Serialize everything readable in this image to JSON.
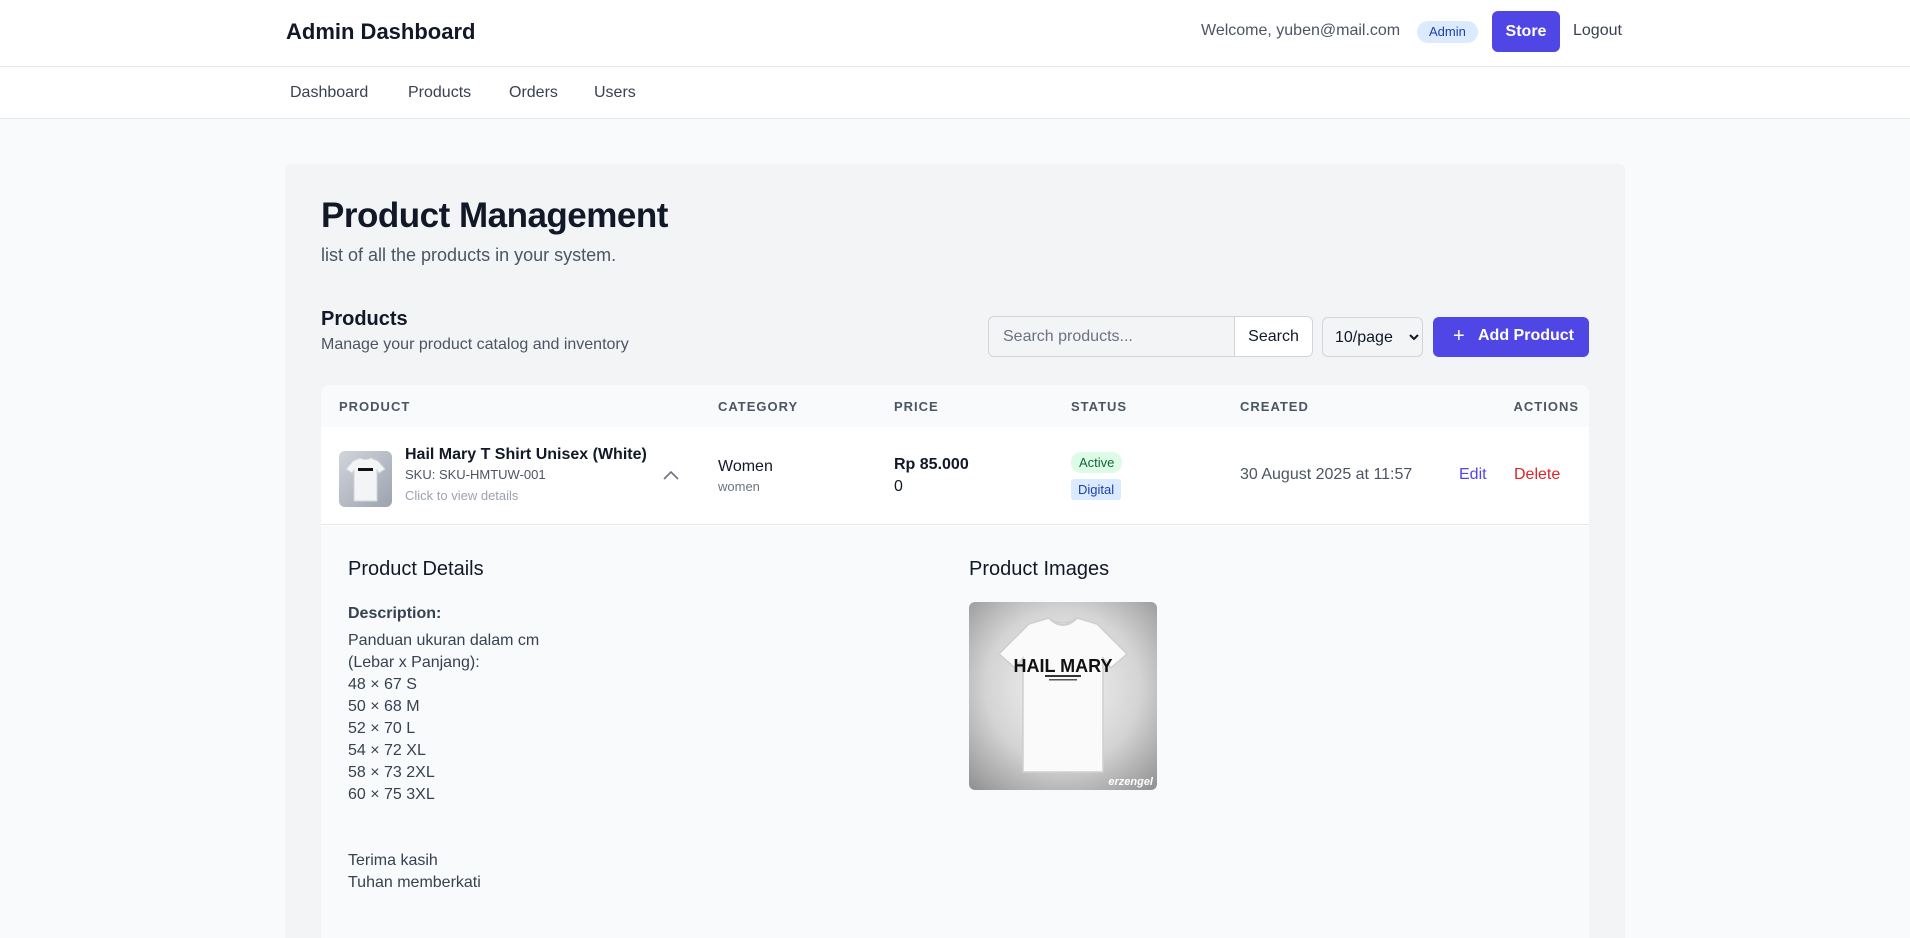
{
  "header": {
    "title": "Admin Dashboard",
    "welcome": "Welcome, yuben@mail.com",
    "role_badge": "Admin",
    "store_label": "Store",
    "logout_label": "Logout"
  },
  "nav": [
    "Dashboard",
    "Products",
    "Orders",
    "Users"
  ],
  "page": {
    "title": "Product Management",
    "subtitle": "list of all the products in your system."
  },
  "products_section": {
    "title": "Products",
    "subtitle": "Manage your product catalog and inventory",
    "search_placeholder": "Search products...",
    "search_label": "Search",
    "per_page": "10/page",
    "add_label": "Add Product"
  },
  "table": {
    "columns": [
      "PRODUCT",
      "CATEGORY",
      "PRICE",
      "STATUS",
      "CREATED",
      "ACTIONS"
    ],
    "rows": [
      {
        "name": "Hail Mary T Shirt Unisex (White)",
        "sku": "SKU: SKU-HMTUW-001",
        "hint": "Click to view details",
        "category": "Women",
        "category_slug": "women",
        "price": "Rp 85.000",
        "stock": "0",
        "status": "Active",
        "type": "Digital",
        "created": "30 August 2025 at 11:57",
        "edit_label": "Edit",
        "delete_label": "Delete"
      }
    ]
  },
  "details": {
    "title": "Product Details",
    "description_label": "Description:",
    "description": "Panduan ukuran dalam cm\n(Lebar x Panjang):\n48 × 67 S\n50 × 68 M\n52 × 70 L\n54 × 72 XL\n58 × 73 2XL\n60 × 75 3XL\n\n\nTerima kasih\nTuhan memberkati",
    "images_title": "Product Images",
    "image_text": "HAIL MARY",
    "image_watermark": "erzengel"
  },
  "colors": {
    "primary": "#4f46e5",
    "danger": "#dc2626",
    "active_bg": "#dcfce7",
    "digital_bg": "#dbeafe"
  }
}
